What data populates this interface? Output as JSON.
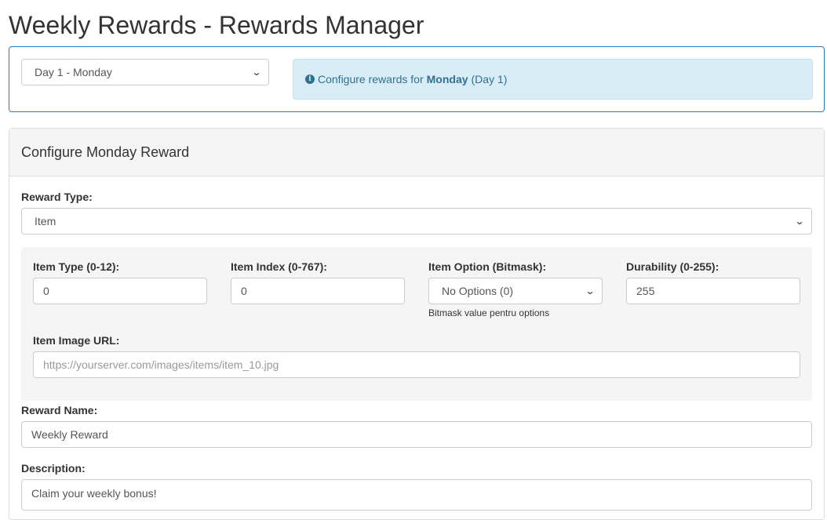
{
  "page": {
    "title": "Weekly Rewards - Rewards Manager"
  },
  "day_selector": {
    "selected": "Day 1 - Monday"
  },
  "info": {
    "prefix": "Configure rewards for",
    "day_name": "Monday",
    "suffix": "(Day 1)"
  },
  "panel": {
    "heading": "Configure Monday Reward"
  },
  "reward_type": {
    "label": "Reward Type:",
    "selected": "Item"
  },
  "item": {
    "type_label": "Item Type (0-12):",
    "type_value": "0",
    "index_label": "Item Index (0-767):",
    "index_value": "0",
    "option_label": "Item Option (Bitmask):",
    "option_selected": "No Options (0)",
    "option_help": "Bitmask value pentru options",
    "durability_label": "Durability (0-255):",
    "durability_value": "255",
    "image_label": "Item Image URL:",
    "image_placeholder": "https://yourserver.com/images/items/item_10.jpg"
  },
  "reward_name": {
    "label": "Reward Name:",
    "value": "Weekly Reward"
  },
  "description": {
    "label": "Description:",
    "value": "Claim your weekly bonus!"
  },
  "colors": {
    "primary": "#337ab7",
    "info_bg": "#d9edf7",
    "info_text": "#31708f"
  }
}
